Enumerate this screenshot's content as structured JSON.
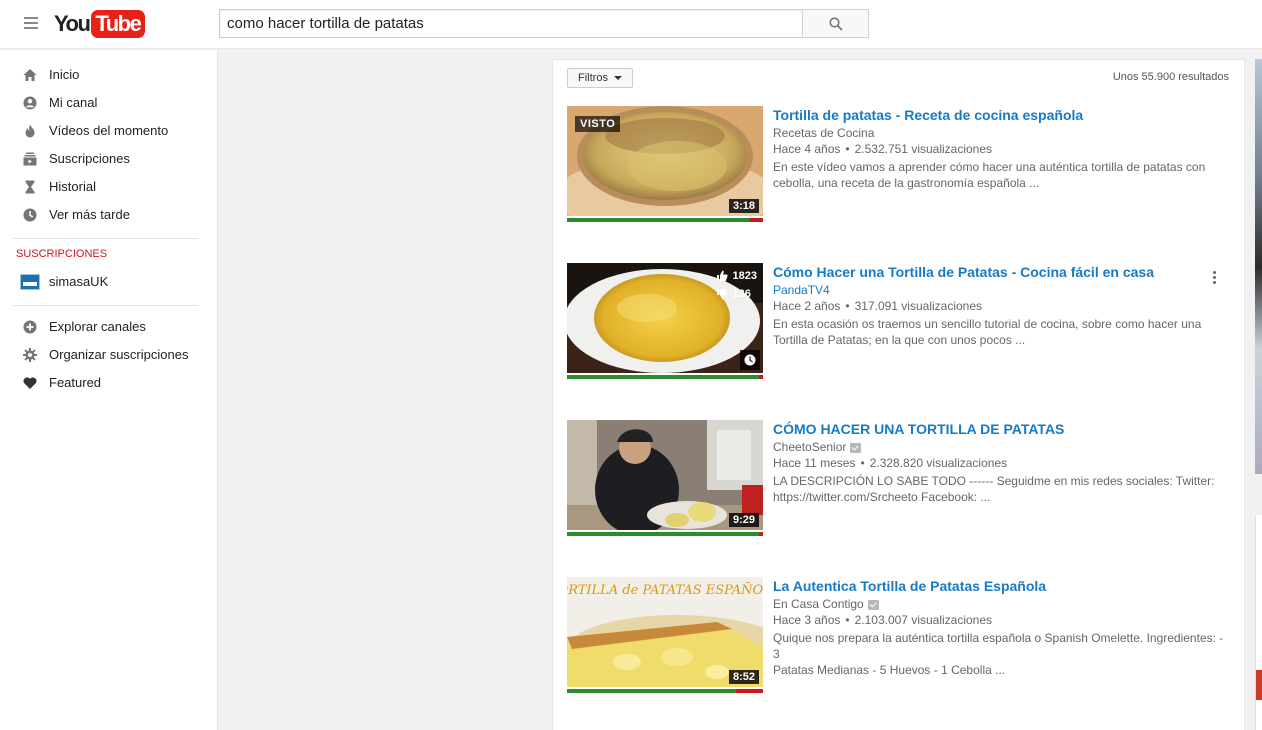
{
  "header": {
    "logo_you": "You",
    "logo_tube": "Tube",
    "search_value": "como hacer tortilla de patatas",
    "menu_icon": "hamburger-icon",
    "search_icon": "search-icon"
  },
  "sidebar": {
    "items": [
      {
        "label": "Inicio",
        "icon": "home-icon"
      },
      {
        "label": "Mi canal",
        "icon": "user-icon"
      },
      {
        "label": "Vídeos del momento",
        "icon": "flame-icon"
      },
      {
        "label": "Suscripciones",
        "icon": "subscriptions-icon"
      },
      {
        "label": "Historial",
        "icon": "hourglass-icon"
      },
      {
        "label": "Ver más tarde",
        "icon": "clock-icon"
      }
    ],
    "subscriptions_title": "SUSCRIPCIONES",
    "subscriptions": [
      {
        "label": "simasaUK",
        "icon": "channel-avatar"
      }
    ],
    "bottom_items": [
      {
        "label": "Explorar canales",
        "icon": "plus-circle-icon"
      },
      {
        "label": "Organizar suscripciones",
        "icon": "gear-icon"
      },
      {
        "label": "Featured",
        "icon": "heart-icon"
      }
    ]
  },
  "results": {
    "filter_label": "Filtros",
    "count_text": "Unos 55.900 resultados",
    "items": [
      {
        "title": "Tortilla de patatas - Receta de cocina española",
        "channel": "Recetas de Cocina",
        "age": "Hace 4 años",
        "views": "2.532.751 visualizaciones",
        "desc_line1": "En este vídeo vamos a aprender cómo hacer una auténtica tortilla de patatas con",
        "desc_line2": "cebolla, una receta de la gastronomía española ...",
        "duration": "3:18",
        "badge": "VISTO",
        "watched_fraction": 0.93
      },
      {
        "title": "Cómo Hacer una Tortilla de Patatas - Cocina fácil en casa",
        "channel": "PandaTV4",
        "age": "Hace 2 años",
        "views": "317.091 visualizaciones",
        "desc_line1": "En esta ocasión os traemos un sencillo tutorial de cocina, sobre como hacer una",
        "desc_line2": "Tortilla de Patatas; en la que con unos pocos ...",
        "likes": "1823",
        "dislikes": "136",
        "watched_fraction": 0.98
      },
      {
        "title": "CÓMO HACER UNA TORTILLA DE PATATAS",
        "channel": "CheetoSenior",
        "age": "Hace 11 meses",
        "views": "2.328.820 visualizaciones",
        "desc_line1": "LA DESCRIPCIÓN LO SABE TODO ------ Seguidme en mis redes sociales: Twitter:",
        "desc_line2": "https://twitter.com/Srcheeto Facebook: ...",
        "duration": "9:29",
        "watched_fraction": 0.98
      },
      {
        "title": "La Autentica Tortilla de Patatas Española",
        "channel": "En Casa Contigo",
        "age": "Hace 3 años",
        "views": "2.103.007 visualizaciones",
        "desc_line1": "Quique nos prepara la auténtica tortilla española o Spanish Omelette. Ingredientes: - 3",
        "desc_line2": "Patatas Medianas - 5 Huevos - 1 Cebolla ...",
        "duration": "8:52",
        "thumb_text": "TORTILLA de PATATAS ESPAÑOLA",
        "watched_fraction": 0.86
      }
    ]
  },
  "colors": {
    "link_blue": "#167ac6",
    "youtube_red": "#e62117",
    "progress_green": "#2e8b2e",
    "section_red": "#cc181e"
  }
}
